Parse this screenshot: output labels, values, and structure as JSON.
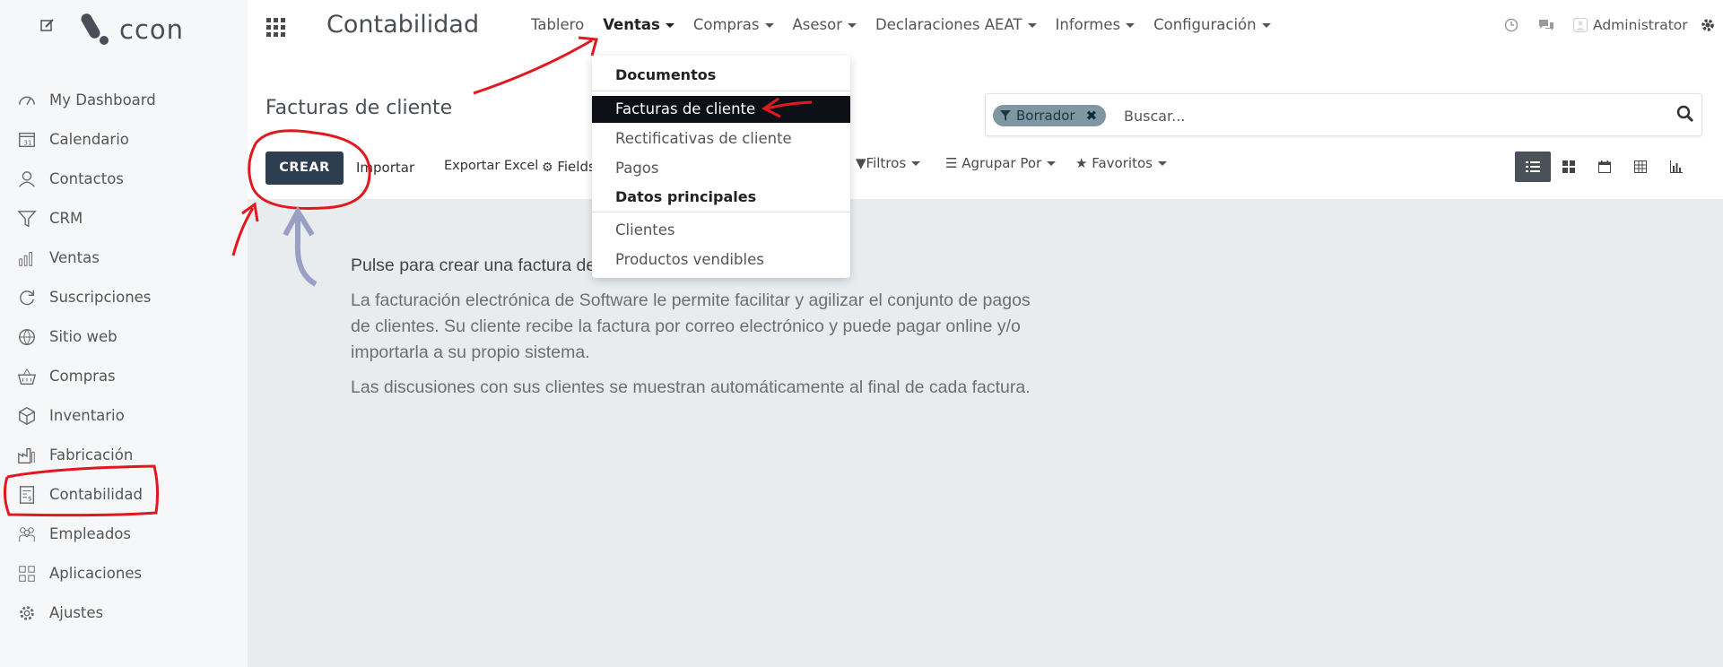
{
  "brand": {
    "logo_text": "ccon"
  },
  "sidebar": {
    "items": [
      {
        "label": "My Dashboard",
        "icon": "gauge-icon"
      },
      {
        "label": "Calendario",
        "icon": "calendar-icon"
      },
      {
        "label": "Contactos",
        "icon": "user-icon"
      },
      {
        "label": "CRM",
        "icon": "funnel-icon"
      },
      {
        "label": "Ventas",
        "icon": "bar-chart-icon"
      },
      {
        "label": "Suscripciones",
        "icon": "refresh-icon"
      },
      {
        "label": "Sitio web",
        "icon": "globe-icon"
      },
      {
        "label": "Compras",
        "icon": "basket-icon"
      },
      {
        "label": "Inventario",
        "icon": "box-icon"
      },
      {
        "label": "Fabricación",
        "icon": "factory-icon"
      },
      {
        "label": "Contabilidad",
        "icon": "invoice-icon"
      },
      {
        "label": "Empleados",
        "icon": "people-icon"
      },
      {
        "label": "Aplicaciones",
        "icon": "grid-icon"
      },
      {
        "label": "Ajustes",
        "icon": "gear-icon"
      }
    ]
  },
  "topbar": {
    "app_title": "Contabilidad",
    "nav": [
      "Tablero",
      "Ventas",
      "Compras",
      "Asesor",
      "Declaraciones AEAT",
      "Informes",
      "Configuración"
    ],
    "user": "Administrator"
  },
  "dropdown": {
    "section1": "Documentos",
    "section1_items": [
      "Facturas de cliente",
      "Rectificativas de cliente",
      "Pagos"
    ],
    "section2": "Datos principales",
    "section2_items": [
      "Clientes",
      "Productos vendibles"
    ]
  },
  "control": {
    "page_title": "Facturas de cliente",
    "create": "CREAR",
    "import": "Importar",
    "export": "Exportar Excel",
    "fields": "Fields",
    "filters": "Filtros",
    "group_by": "Agrupar Por",
    "favorites": "Favoritos",
    "facet": "Borrador",
    "search_placeholder": "Buscar..."
  },
  "help": {
    "title": "Pulse para crear una factura de cliente",
    "p1": "La facturación electrónica de Software le permite facilitar y agilizar el conjunto de pagos de clientes. Su cliente recibe la factura por correo electrónico y puede pagar online y/o importarla a su propio sistema.",
    "p2": "Las discusiones con sus clientes se muestran automáticamente al final de cada factura."
  },
  "colors": {
    "annotation_red": "#e0191f",
    "primary": "#2c3e50",
    "facet": "#7f97a3"
  }
}
